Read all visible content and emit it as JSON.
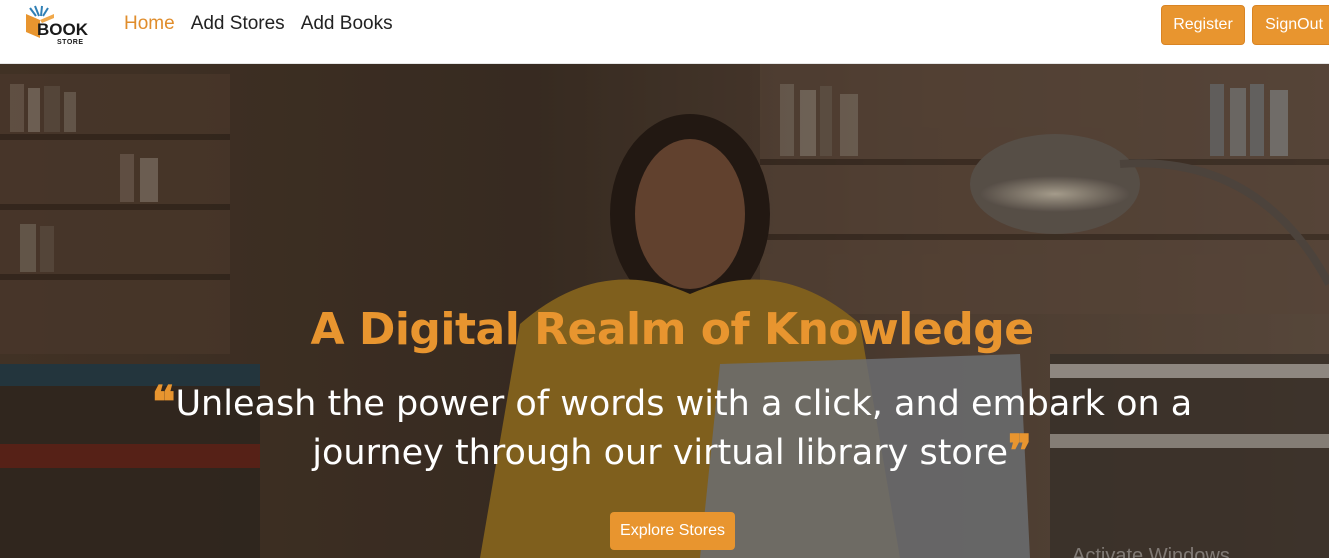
{
  "brand": {
    "logo_book": "BOOK",
    "logo_store": "STORE"
  },
  "nav": {
    "links": [
      {
        "label": "Home",
        "active": true
      },
      {
        "label": "Add Stores",
        "active": false
      },
      {
        "label": "Add Books",
        "active": false
      }
    ],
    "register_label": "Register",
    "signout_label": "SignOut"
  },
  "hero": {
    "title": "A Digital Realm of Knowledge",
    "quote": "Unleash the power of words with a click, and embark on a journey through our virtual library store",
    "cta_label": "Explore Stores",
    "watermark": "Activate Windows"
  },
  "colors": {
    "accent": "#e8952f",
    "nav_active": "#e08d2c",
    "quote_text": "#ffffff"
  }
}
